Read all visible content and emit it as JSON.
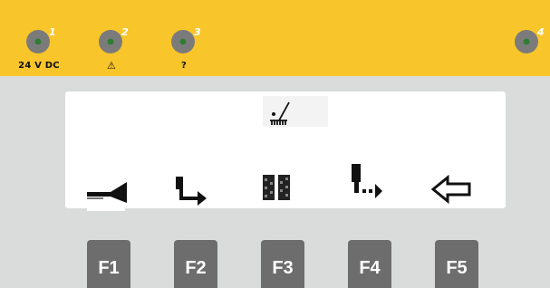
{
  "colors": {
    "status_bar": "#f8c52a",
    "panel_background": "#dadbdb",
    "led_body": "#7b7b7b",
    "led_on": "#2e7d32",
    "function_key": "#6d6d6d"
  },
  "status_leds": [
    {
      "number": "1",
      "caption": "24 V DC"
    },
    {
      "number": "2",
      "caption": "⚠"
    },
    {
      "number": "3",
      "caption": "?"
    },
    {
      "number": "4",
      "caption": ""
    }
  ],
  "display": {
    "title_icon": "rake-icon",
    "softkey_icons": [
      "feed-nozzle-icon",
      "move-down-left-icon",
      "tread-pattern-icon",
      "move-down-right-icon",
      "back-arrow-icon"
    ]
  },
  "function_keys": [
    {
      "label": "F1"
    },
    {
      "label": "F2"
    },
    {
      "label": "F3"
    },
    {
      "label": "F4"
    },
    {
      "label": "F5"
    }
  ]
}
